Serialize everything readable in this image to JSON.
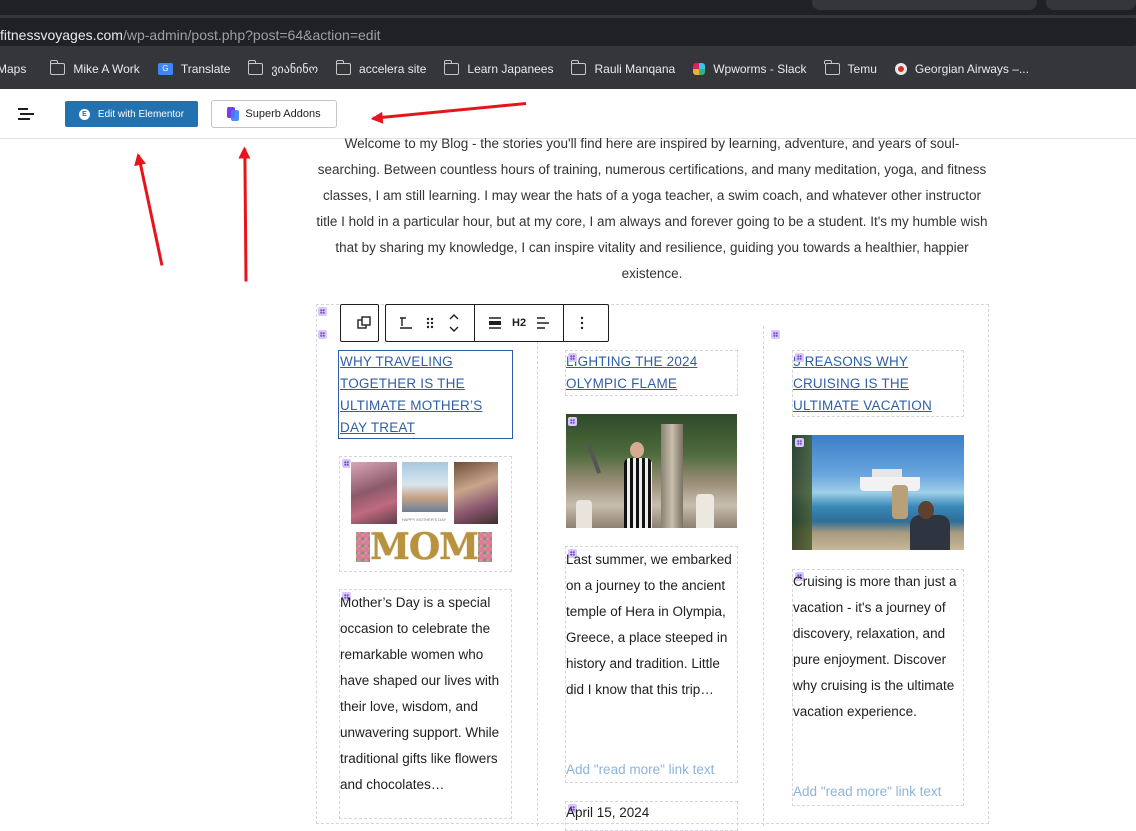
{
  "browser": {
    "url_host": "fitnessvoyages.com",
    "url_path": "/wp-admin/post.php?post=64&action=edit",
    "bookmarks": [
      {
        "label": "Maps",
        "icon": "maps-icon"
      },
      {
        "label": "Mike A Work",
        "icon": "folder-icon"
      },
      {
        "label": "Translate",
        "icon": "google-translate-icon"
      },
      {
        "label": "ვიანინო",
        "icon": "folder-icon"
      },
      {
        "label": "accelera site",
        "icon": "folder-icon"
      },
      {
        "label": "Learn Japanees",
        "icon": "folder-icon"
      },
      {
        "label": "Rauli Manqana",
        "icon": "folder-icon"
      },
      {
        "label": "Wpworms - Slack",
        "icon": "slack-icon"
      },
      {
        "label": "Temu",
        "icon": "folder-icon"
      },
      {
        "label": "Georgian Airways –...",
        "icon": "georgian-airways-icon"
      }
    ]
  },
  "editor_toolbar": {
    "elementor_label": "Edit with Elementor",
    "superb_label": "Superb Addons"
  },
  "intro_text": "Welcome to my Blog - the stories you'll find here are inspired by learning, adventure, and years of soul-searching. Between countless hours of training, numerous certifications, and many meditation, yoga, and fitness classes, I am still learning. I may wear the hats of a yoga teacher, a swim coach, and whatever other instructor title I hold in a particular hour, but at my core, I am always and forever going to be a student. It's my humble wish that by sharing my knowledge, I can inspire vitality and resilience, guiding you towards a healthier, happier existence.",
  "block_toolbar": {
    "heading_level": "H2"
  },
  "posts": [
    {
      "title": "WHY TRAVELING TOGETHER IS THE ULTIMATE MOTHER’S DAY TREAT",
      "image_text": "MOM",
      "image_caption": "HAPPY MOTHER'S DAY",
      "excerpt": "Mother’s Day is a special occasion to celebrate the remarkable women who have shaped our lives with their love, wisdom, and unwavering support. While traditional gifts like flowers and chocolates…"
    },
    {
      "title": "LIGHTING THE 2024 OLYMPIC FLAME",
      "excerpt": "Last summer, we embarked on a journey to the ancient temple of Hera in Olympia, Greece, a place steeped in history and tradition. Little did I know that this trip…",
      "read_more": "Add \"read more\" link text",
      "date": "April 15, 2024"
    },
    {
      "title": "5 REASONS WHY CRUISING IS THE ULTIMATE VACATION",
      "excerpt": "Cruising is more than just a vacation - it's a journey of discovery, relaxation, and pure enjoyment. Discover why cruising is the ultimate vacation experience.",
      "read_more": "Add \"read more\" link text"
    }
  ]
}
